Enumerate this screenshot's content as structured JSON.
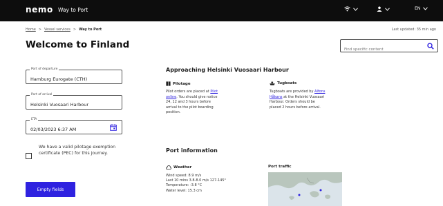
{
  "header": {
    "logo": "nemo",
    "app_title": "Way to Port",
    "language": "EN"
  },
  "breadcrumb": {
    "items": [
      "Home",
      "Vessel services",
      "Way to Port"
    ],
    "separator": ">"
  },
  "last_updated": "Last updated: 35 min ago",
  "page_title": "Welcome to Finland",
  "search": {
    "placeholder": "Find specific content"
  },
  "form": {
    "departure": {
      "label": "Port of departure",
      "value": "Hamburg Eurogate (CTH)"
    },
    "arrival": {
      "label": "Port of arrival",
      "value": "Helsinki Vuosaari Harbour"
    },
    "eta": {
      "label": "ETA",
      "value": "02/03/2023 6:37 AM"
    },
    "pec_checkbox": {
      "label": "We have a valid pilotage exemption certificate (PEC) for this journey.",
      "checked": false
    },
    "empty_button": "Empty fields"
  },
  "approach": {
    "title": "Approaching Helsinki Vuosaari Harbour",
    "pilotage": {
      "heading": "Pilotage",
      "text_before": "Pilot orders are placed at",
      "link": "Pilot online",
      "text_after": ". You should give notice 24, 12 and 3 hours before arrival to the pilot boarding position."
    },
    "tugboats": {
      "heading": "Tugboats",
      "text_before": "Tugboats are provided by",
      "link": "Alfons Håkans",
      "text_after": " at the Helsinki Vuosaari Harbour. Orders should be placed 2 hours before arrival."
    }
  },
  "port_info": {
    "title": "Port information",
    "weather": {
      "heading": "Weather",
      "lines": [
        "Wind speed: 8.9 m/s",
        "Last 10 mins 3.8-8.0 m/s 127-145°",
        "Temperature: -3.8 °C",
        "Water level: 15.3 cm"
      ]
    },
    "traffic": {
      "heading": "Port traffic"
    }
  },
  "colors": {
    "topbar": "#0d0d0d",
    "accent": "#2f22e0",
    "map_water": "#dbe4ea",
    "map_land": "#b9c6bd"
  }
}
